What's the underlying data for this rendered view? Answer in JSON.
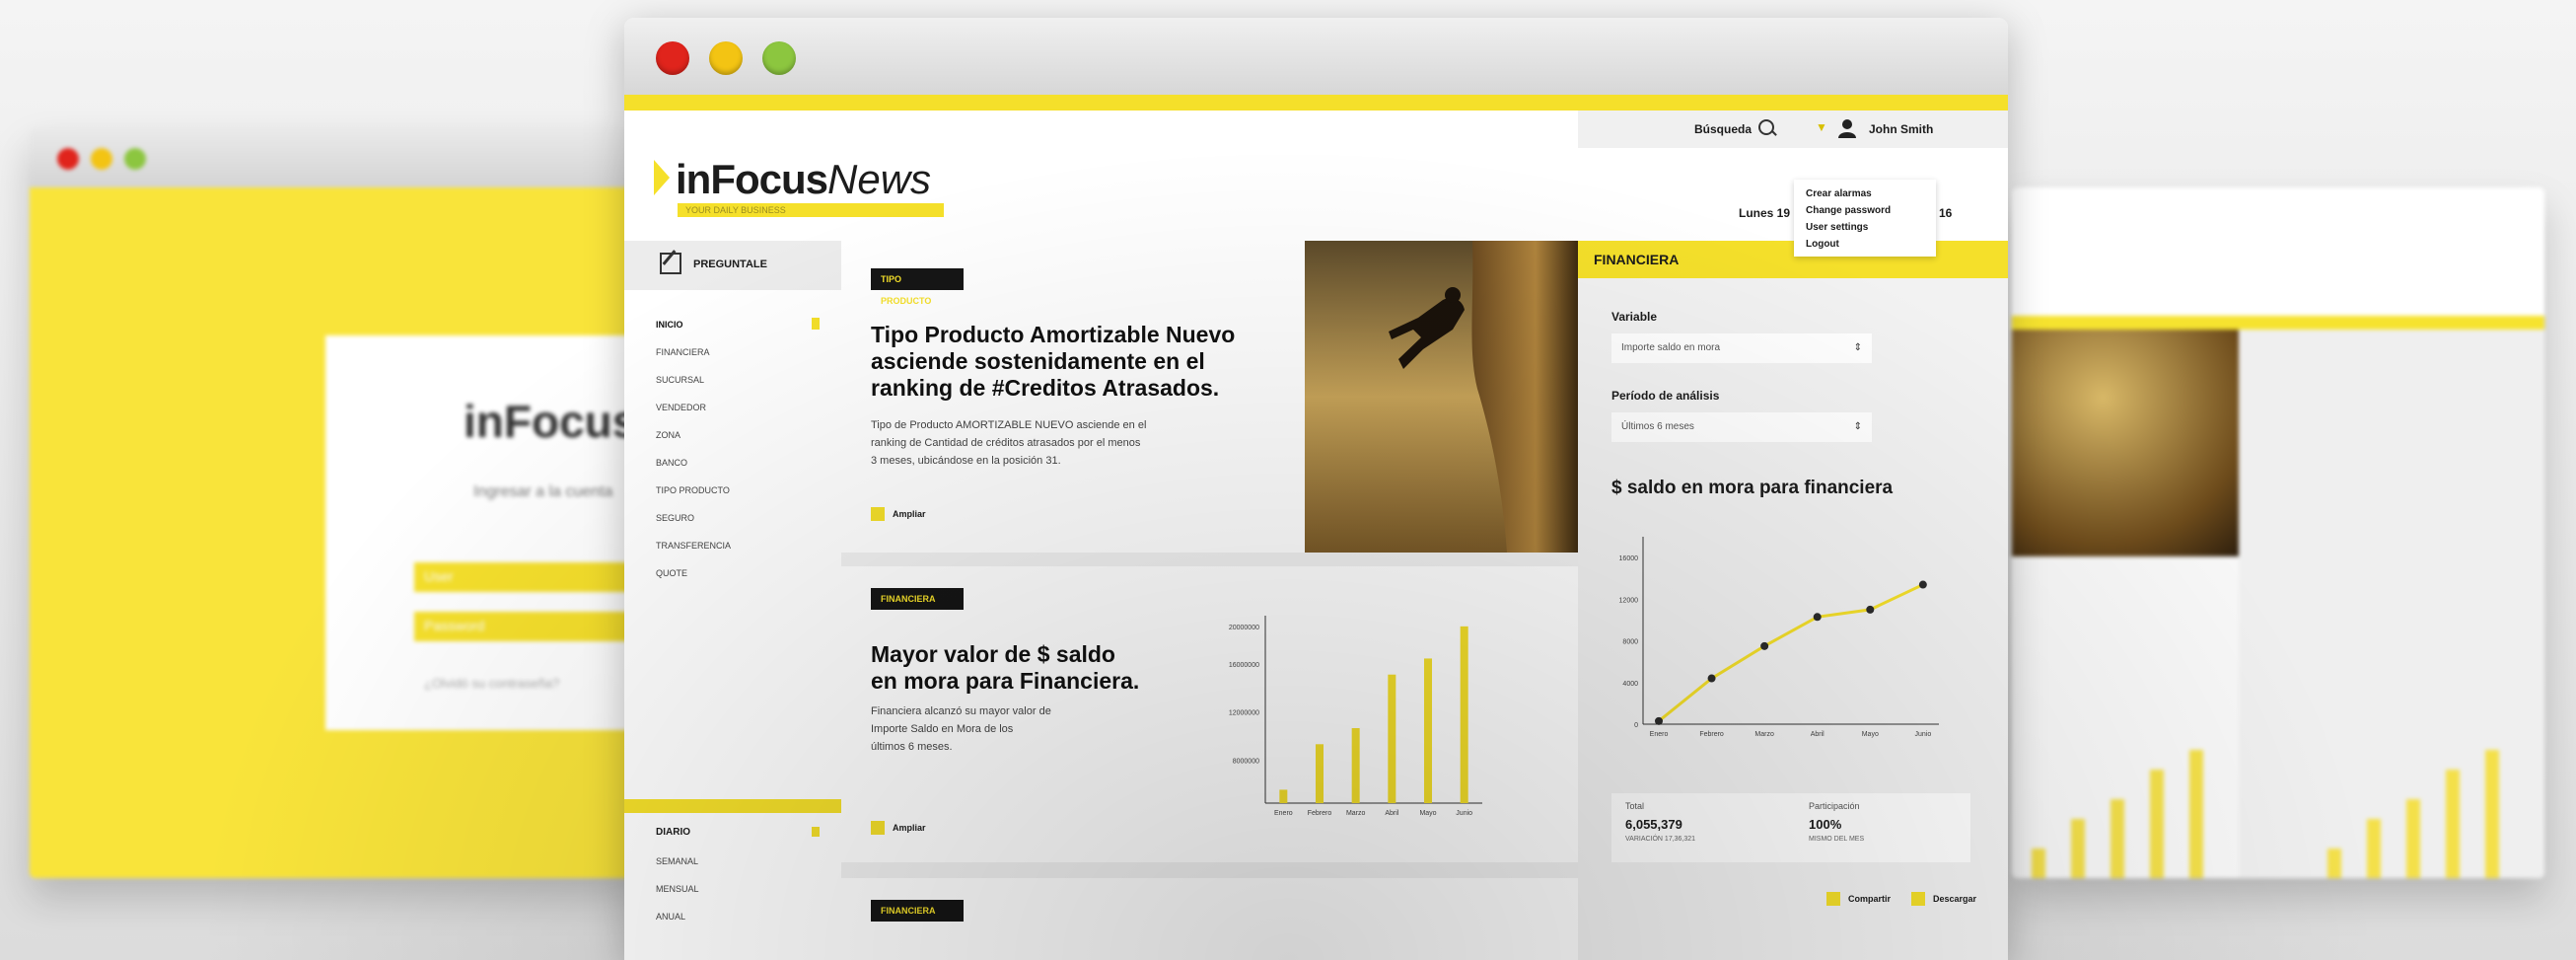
{
  "window": {
    "traffic_lights": [
      "#e0241c",
      "#f3c413",
      "#8cc63f"
    ]
  },
  "header": {
    "logo_in": "inFocus",
    "logo_news": "News",
    "logo_tagline": "YOUR DAILY BUSINESS",
    "search_label": "Búsqueda",
    "user_name": "John Smith",
    "date_prefix": "Lunes 19",
    "date_suffix": "16",
    "user_menu": [
      "Crear alarmas",
      "Change password",
      "User settings",
      "Logout"
    ]
  },
  "sidebar": {
    "title": "PREGUNTALE",
    "items": [
      "INICIO",
      "FINANCIERA",
      "SUCURSAL",
      "VENDEDOR",
      "ZONA",
      "BANCO",
      "TIPO PRODUCTO",
      "SEGURO",
      "TRANSFERENCIA",
      "QUOTE"
    ],
    "lower_title": "DIARIO",
    "lower_items": [
      "SEMANAL",
      "MENSUAL",
      "ANUAL"
    ]
  },
  "articles": [
    {
      "tag": "TIPO PRODUCTO",
      "title_lines": [
        "Tipo Producto Amortizable Nuevo",
        "asciende sostenidamente en el",
        "ranking de #Creditos Atrasados."
      ],
      "body_lines": [
        "Tipo de Producto AMORTIZABLE NUEVO asciende en el",
        "ranking de Cantidad de créditos atrasados por el menos",
        "3 meses, ubicándose en la posición 31."
      ],
      "more": "Ampliar"
    },
    {
      "tag": "FINANCIERA",
      "title_lines": [
        "Mayor valor de $ saldo",
        "en mora para Financiera."
      ],
      "body_lines": [
        "Financiera alcanzó su mayor valor de",
        "Importe Saldo en Mora de los",
        "últimos 6 meses."
      ],
      "more": "Ampliar"
    },
    {
      "tag": "FINANCIERA"
    }
  ],
  "bar_chart": {
    "type": "bar",
    "categories": [
      "Enero",
      "Febrero",
      "Marzo",
      "Abril",
      "Mayo",
      "Junio"
    ],
    "values": [
      2.5,
      11,
      14,
      24,
      27,
      33
    ],
    "ylim": [
      0,
      35
    ],
    "yticks": [
      {
        "v": 8,
        "label": "8000000"
      },
      {
        "v": 17,
        "label": "12000000"
      },
      {
        "v": 26,
        "label": "16000000"
      },
      {
        "v": 33,
        "label": "20000000"
      }
    ],
    "xticklabels": [
      "Enero",
      "Febrero",
      "Marzo",
      "Abril",
      "Mayo",
      "Junio"
    ],
    "color": "#f5e02a"
  },
  "panel": {
    "title": "FINANCIERA",
    "variable_label": "Variable",
    "variable_value": "Importe saldo en mora",
    "period_label": "Período de análisis",
    "period_value": "Últimos 6 meses",
    "chart_title": "$ saldo en mora para financiera",
    "stats": [
      {
        "label": "Total",
        "value": "6,055,379",
        "sub": "VARIACIÓN 17,36,321"
      },
      {
        "label": "Participación",
        "value": "100%",
        "sub": "MISMO DEL MES"
      }
    ],
    "foot": [
      "Compartir",
      "Descargar"
    ]
  },
  "chart_data": {
    "type": "line",
    "x": [
      "Enero",
      "Febrero",
      "Marzo",
      "Abril",
      "Mayo",
      "Junio"
    ],
    "series": [
      {
        "values": [
          0.3,
          4.4,
          7.5,
          10.3,
          11.0,
          13.4
        ]
      }
    ],
    "ylim": [
      0,
      18
    ],
    "yticks": [
      {
        "v": 0,
        "label": "0"
      },
      {
        "v": 4,
        "label": "4000"
      },
      {
        "v": 8,
        "label": "8000"
      },
      {
        "v": 12,
        "label": "12000"
      },
      {
        "v": 16,
        "label": "16000"
      }
    ],
    "color": "#f5e02a"
  },
  "ghost_left": {
    "logo": "inFocus",
    "title": "Ingresar a la cuenta",
    "fields": [
      "User",
      "Password"
    ],
    "note": "¿Olvidó su contraseña?"
  }
}
